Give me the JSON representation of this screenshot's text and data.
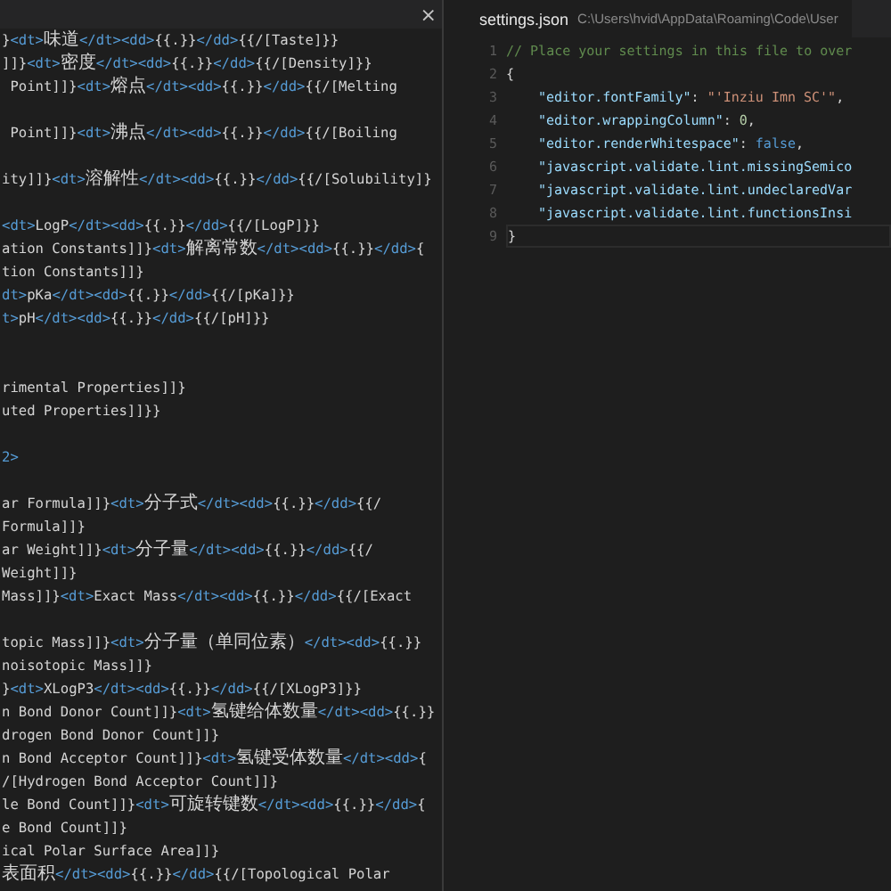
{
  "left_editor": {
    "close_icon": "×",
    "lines": [
      {
        "kind": "code",
        "segments": [
          {
            "kind": "text",
            "text": "}"
          },
          {
            "kind": "tag",
            "text": "<dt>"
          },
          {
            "kind": "cjk",
            "text": "味道"
          },
          {
            "kind": "tag",
            "text": "</dt><dd>"
          },
          {
            "kind": "text",
            "text": "{{.}}"
          },
          {
            "kind": "tag",
            "text": "</dd>"
          },
          {
            "kind": "text",
            "text": "{{/[Taste]}}"
          }
        ]
      },
      {
        "kind": "code",
        "segments": [
          {
            "kind": "text",
            "text": "]]}"
          },
          {
            "kind": "tag",
            "text": "<dt>"
          },
          {
            "kind": "cjk",
            "text": "密度"
          },
          {
            "kind": "tag",
            "text": "</dt><dd>"
          },
          {
            "kind": "text",
            "text": "{{.}}"
          },
          {
            "kind": "tag",
            "text": "</dd>"
          },
          {
            "kind": "text",
            "text": "{{/[Density]}}"
          }
        ]
      },
      {
        "kind": "code",
        "segments": [
          {
            "kind": "text",
            "text": " Point]]}"
          },
          {
            "kind": "tag",
            "text": "<dt>"
          },
          {
            "kind": "cjk",
            "text": "熔点"
          },
          {
            "kind": "tag",
            "text": "</dt><dd>"
          },
          {
            "kind": "text",
            "text": "{{.}}"
          },
          {
            "kind": "tag",
            "text": "</dd>"
          },
          {
            "kind": "text",
            "text": "{{/[Melting"
          }
        ]
      },
      {
        "kind": "blank"
      },
      {
        "kind": "code",
        "segments": [
          {
            "kind": "text",
            "text": " Point]]}"
          },
          {
            "kind": "tag",
            "text": "<dt>"
          },
          {
            "kind": "cjk",
            "text": "沸点"
          },
          {
            "kind": "tag",
            "text": "</dt><dd>"
          },
          {
            "kind": "text",
            "text": "{{.}}"
          },
          {
            "kind": "tag",
            "text": "</dd>"
          },
          {
            "kind": "text",
            "text": "{{/[Boiling"
          }
        ]
      },
      {
        "kind": "blank"
      },
      {
        "kind": "code",
        "segments": [
          {
            "kind": "text",
            "text": "ity]]}"
          },
          {
            "kind": "tag",
            "text": "<dt>"
          },
          {
            "kind": "cjk",
            "text": "溶解性"
          },
          {
            "kind": "tag",
            "text": "</dt><dd>"
          },
          {
            "kind": "text",
            "text": "{{.}}"
          },
          {
            "kind": "tag",
            "text": "</dd>"
          },
          {
            "kind": "text",
            "text": "{{/[Solubility]}"
          }
        ]
      },
      {
        "kind": "blank"
      },
      {
        "kind": "code",
        "segments": [
          {
            "kind": "tag",
            "text": "<dt>"
          },
          {
            "kind": "text",
            "text": "LogP"
          },
          {
            "kind": "tag",
            "text": "</dt><dd>"
          },
          {
            "kind": "text",
            "text": "{{.}}"
          },
          {
            "kind": "tag",
            "text": "</dd>"
          },
          {
            "kind": "text",
            "text": "{{/[LogP]}}"
          }
        ]
      },
      {
        "kind": "code",
        "segments": [
          {
            "kind": "text",
            "text": "ation Constants]]}"
          },
          {
            "kind": "tag",
            "text": "<dt>"
          },
          {
            "kind": "cjk",
            "text": "解离常数"
          },
          {
            "kind": "tag",
            "text": "</dt><dd>"
          },
          {
            "kind": "text",
            "text": "{{.}}"
          },
          {
            "kind": "tag",
            "text": "</dd>"
          },
          {
            "kind": "text",
            "text": "{"
          }
        ]
      },
      {
        "kind": "code",
        "segments": [
          {
            "kind": "text",
            "text": "tion Constants]]}"
          }
        ]
      },
      {
        "kind": "code",
        "segments": [
          {
            "kind": "tag",
            "text": "dt>"
          },
          {
            "kind": "text",
            "text": "pKa"
          },
          {
            "kind": "tag",
            "text": "</dt><dd>"
          },
          {
            "kind": "text",
            "text": "{{.}}"
          },
          {
            "kind": "tag",
            "text": "</dd>"
          },
          {
            "kind": "text",
            "text": "{{/[pKa]}}"
          }
        ]
      },
      {
        "kind": "code",
        "segments": [
          {
            "kind": "tag",
            "text": "t>"
          },
          {
            "kind": "text",
            "text": "pH"
          },
          {
            "kind": "tag",
            "text": "</dt><dd>"
          },
          {
            "kind": "text",
            "text": "{{.}}"
          },
          {
            "kind": "tag",
            "text": "</dd>"
          },
          {
            "kind": "text",
            "text": "{{/[pH]}}"
          }
        ]
      },
      {
        "kind": "blank"
      },
      {
        "kind": "blank"
      },
      {
        "kind": "code",
        "segments": [
          {
            "kind": "text",
            "text": "rimental Properties]]}"
          }
        ]
      },
      {
        "kind": "code",
        "segments": [
          {
            "kind": "text",
            "text": "uted Properties]]}}"
          }
        ]
      },
      {
        "kind": "blank"
      },
      {
        "kind": "code",
        "segments": [
          {
            "kind": "tag",
            "text": "2>"
          }
        ]
      },
      {
        "kind": "blank"
      },
      {
        "kind": "code",
        "segments": [
          {
            "kind": "text",
            "text": "ar Formula]]}"
          },
          {
            "kind": "tag",
            "text": "<dt>"
          },
          {
            "kind": "cjk",
            "text": "分子式"
          },
          {
            "kind": "tag",
            "text": "</dt><dd>"
          },
          {
            "kind": "text",
            "text": "{{.}}"
          },
          {
            "kind": "tag",
            "text": "</dd>"
          },
          {
            "kind": "text",
            "text": "{{/"
          }
        ]
      },
      {
        "kind": "code",
        "segments": [
          {
            "kind": "text",
            "text": "Formula]]}"
          }
        ]
      },
      {
        "kind": "code",
        "segments": [
          {
            "kind": "text",
            "text": "ar Weight]]}"
          },
          {
            "kind": "tag",
            "text": "<dt>"
          },
          {
            "kind": "cjk",
            "text": "分子量"
          },
          {
            "kind": "tag",
            "text": "</dt><dd>"
          },
          {
            "kind": "text",
            "text": "{{.}}"
          },
          {
            "kind": "tag",
            "text": "</dd>"
          },
          {
            "kind": "text",
            "text": "{{/"
          }
        ]
      },
      {
        "kind": "code",
        "segments": [
          {
            "kind": "text",
            "text": "Weight]]}"
          }
        ]
      },
      {
        "kind": "code",
        "segments": [
          {
            "kind": "text",
            "text": "Mass]]}"
          },
          {
            "kind": "tag",
            "text": "<dt>"
          },
          {
            "kind": "text",
            "text": "Exact Mass"
          },
          {
            "kind": "tag",
            "text": "</dt><dd>"
          },
          {
            "kind": "text",
            "text": "{{.}}"
          },
          {
            "kind": "tag",
            "text": "</dd>"
          },
          {
            "kind": "text",
            "text": "{{/[Exact"
          }
        ]
      },
      {
        "kind": "blank"
      },
      {
        "kind": "code",
        "segments": [
          {
            "kind": "text",
            "text": "topic Mass]]}"
          },
          {
            "kind": "tag",
            "text": "<dt>"
          },
          {
            "kind": "cjk",
            "text": "分子量（单同位素）"
          },
          {
            "kind": "tag",
            "text": "</dt><dd>"
          },
          {
            "kind": "text",
            "text": "{{.}}"
          }
        ]
      },
      {
        "kind": "code",
        "segments": [
          {
            "kind": "text",
            "text": "noisotopic Mass]]}"
          }
        ]
      },
      {
        "kind": "code",
        "segments": [
          {
            "kind": "text",
            "text": "}"
          },
          {
            "kind": "tag",
            "text": "<dt>"
          },
          {
            "kind": "text",
            "text": "XLogP3"
          },
          {
            "kind": "tag",
            "text": "</dt><dd>"
          },
          {
            "kind": "text",
            "text": "{{.}}"
          },
          {
            "kind": "tag",
            "text": "</dd>"
          },
          {
            "kind": "text",
            "text": "{{/[XLogP3]}}"
          }
        ]
      },
      {
        "kind": "code",
        "segments": [
          {
            "kind": "text",
            "text": "n Bond Donor Count]]}"
          },
          {
            "kind": "tag",
            "text": "<dt>"
          },
          {
            "kind": "cjk",
            "text": "氢键给体数量"
          },
          {
            "kind": "tag",
            "text": "</dt><dd>"
          },
          {
            "kind": "text",
            "text": "{{.}}"
          }
        ]
      },
      {
        "kind": "code",
        "segments": [
          {
            "kind": "text",
            "text": "drogen Bond Donor Count]]}"
          }
        ]
      },
      {
        "kind": "code",
        "segments": [
          {
            "kind": "text",
            "text": "n Bond Acceptor Count]]}"
          },
          {
            "kind": "tag",
            "text": "<dt>"
          },
          {
            "kind": "cjk",
            "text": "氢键受体数量"
          },
          {
            "kind": "tag",
            "text": "</dt><dd>"
          },
          {
            "kind": "text",
            "text": "{"
          }
        ]
      },
      {
        "kind": "code",
        "segments": [
          {
            "kind": "text",
            "text": "/[Hydrogen Bond Acceptor Count]]}"
          }
        ]
      },
      {
        "kind": "code",
        "segments": [
          {
            "kind": "text",
            "text": "le Bond Count]]}"
          },
          {
            "kind": "tag",
            "text": "<dt>"
          },
          {
            "kind": "cjk",
            "text": "可旋转键数"
          },
          {
            "kind": "tag",
            "text": "</dt><dd>"
          },
          {
            "kind": "text",
            "text": "{{.}}"
          },
          {
            "kind": "tag",
            "text": "</dd>"
          },
          {
            "kind": "text",
            "text": "{"
          }
        ]
      },
      {
        "kind": "code",
        "segments": [
          {
            "kind": "text",
            "text": "e Bond Count]]}"
          }
        ]
      },
      {
        "kind": "code",
        "segments": [
          {
            "kind": "text",
            "text": "ical Polar Surface Area]]}"
          }
        ]
      },
      {
        "kind": "code",
        "segments": [
          {
            "kind": "cjk",
            "text": "表面积"
          },
          {
            "kind": "tag",
            "text": "</dt><dd>"
          },
          {
            "kind": "text",
            "text": "{{.}}"
          },
          {
            "kind": "tag",
            "text": "</dd>"
          },
          {
            "kind": "text",
            "text": "{{/[Topological Polar"
          }
        ]
      }
    ]
  },
  "right_editor": {
    "tab": {
      "title": "settings.json",
      "path": "C:\\Users\\hvid\\AppData\\Roaming\\Code\\User"
    },
    "lines": [
      {
        "number": "1",
        "segments": [
          {
            "kind": "comment",
            "text": "// Place your settings in this file to over"
          }
        ]
      },
      {
        "number": "2",
        "segments": [
          {
            "kind": "punct",
            "text": "{"
          }
        ]
      },
      {
        "number": "3",
        "indented": true,
        "segments": [
          {
            "kind": "key",
            "text": "\"editor.fontFamily\""
          },
          {
            "kind": "punct",
            "text": ": "
          },
          {
            "kind": "string",
            "text": "\"'Inziu Imn SC'\""
          },
          {
            "kind": "punct",
            "text": ","
          }
        ]
      },
      {
        "number": "4",
        "indented": true,
        "segments": [
          {
            "kind": "key",
            "text": "\"editor.wrappingColumn\""
          },
          {
            "kind": "punct",
            "text": ": "
          },
          {
            "kind": "number",
            "text": "0"
          },
          {
            "kind": "punct",
            "text": ","
          }
        ]
      },
      {
        "number": "5",
        "indented": true,
        "segments": [
          {
            "kind": "key",
            "text": "\"editor.renderWhitespace\""
          },
          {
            "kind": "punct",
            "text": ": "
          },
          {
            "kind": "keyword",
            "text": "false"
          },
          {
            "kind": "punct",
            "text": ","
          }
        ]
      },
      {
        "number": "6",
        "indented": true,
        "segments": [
          {
            "kind": "key",
            "text": "\"javascript.validate.lint.missingSemico"
          }
        ]
      },
      {
        "number": "7",
        "indented": true,
        "segments": [
          {
            "kind": "key",
            "text": "\"javascript.validate.lint.undeclaredVar"
          }
        ]
      },
      {
        "number": "8",
        "indented": true,
        "segments": [
          {
            "kind": "key",
            "text": "\"javascript.validate.lint.functionsInsi"
          }
        ]
      },
      {
        "number": "9",
        "current": true,
        "segments": [
          {
            "kind": "punct",
            "text": "}"
          }
        ]
      }
    ]
  }
}
